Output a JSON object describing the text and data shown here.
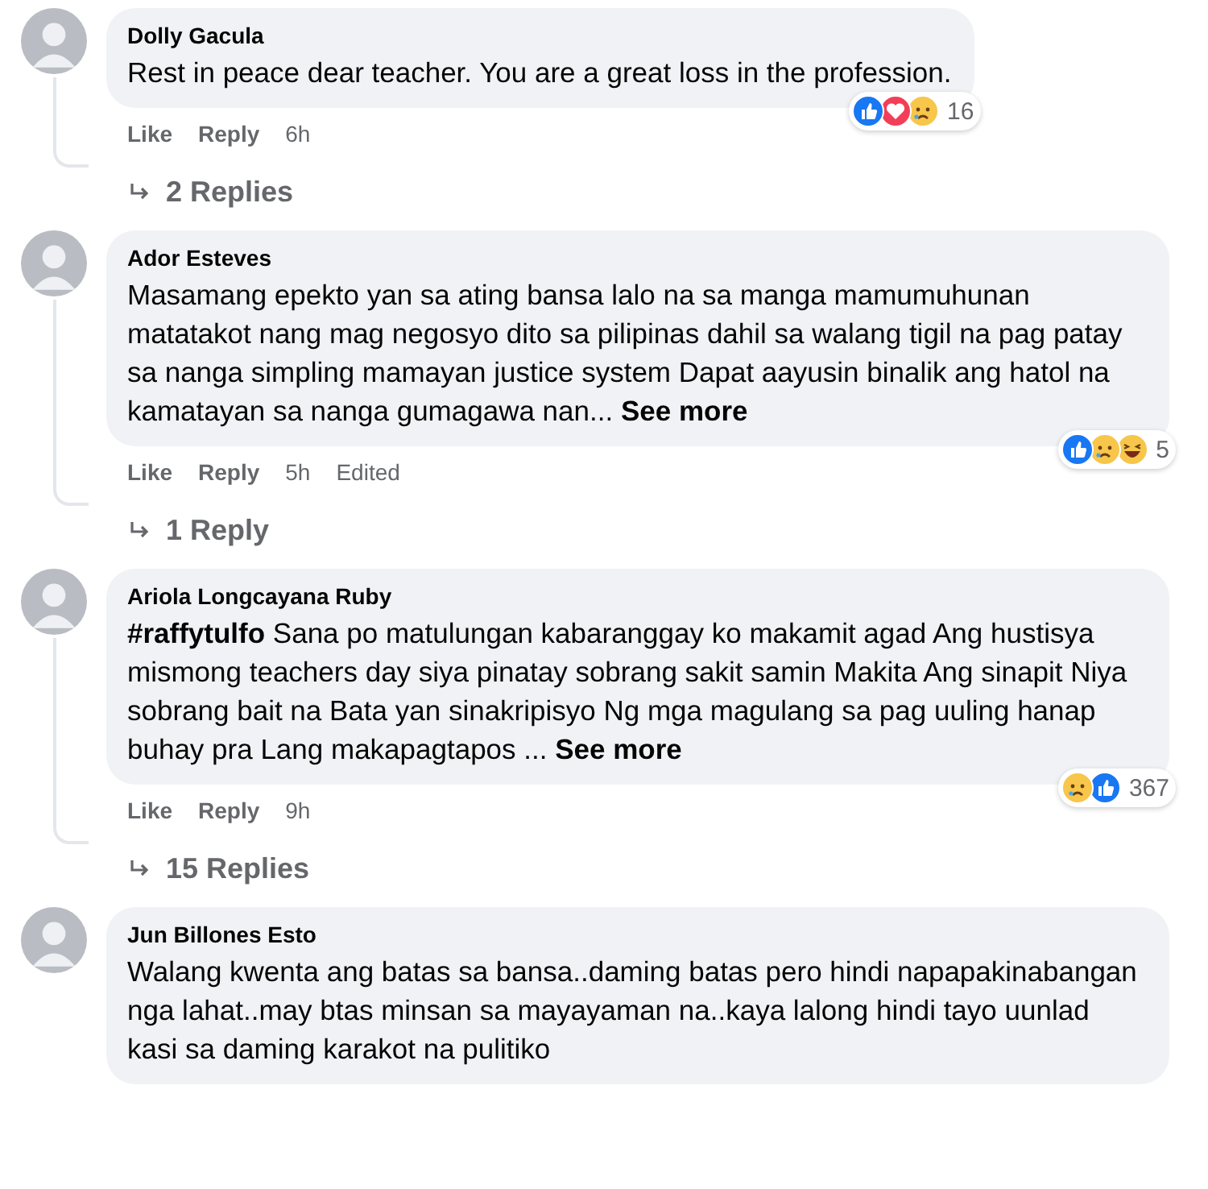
{
  "comments": [
    {
      "author": "Dolly Gacula",
      "body": "Rest in peace dear teacher. You are a great loss in the profession.",
      "actions": [
        "Like",
        "Reply"
      ],
      "time": "6h",
      "reactions": [
        {
          "kind": "like"
        },
        {
          "kind": "love"
        },
        {
          "kind": "sad"
        }
      ],
      "reaction_count": "16",
      "replies": "2 Replies"
    },
    {
      "author": "Ador Esteves",
      "body": "Masamang epekto yan sa ating bansa lalo na sa manga mamumuhunan matatakot nang mag negosyo dito sa pilipinas dahil sa walang tigil na pag patay sa nanga simpling mamayan justice system Dapat aayusin binalik ang hatol na kamatayan sa nanga gumagawa nan... **See more**",
      "actions": [
        "Like",
        "Reply"
      ],
      "time": "5h",
      "edited": "Edited",
      "reactions": [
        {
          "kind": "like"
        },
        {
          "kind": "sad"
        },
        {
          "kind": "haha"
        }
      ],
      "reaction_count": "5",
      "replies": "1 Reply"
    },
    {
      "author": "Ariola Longcayana Ruby",
      "body": "**#raffytulfo** Sana po matulungan kabaranggay ko makamit agad Ang hustisya mismong teachers day siya pinatay sobrang sakit samin Makita Ang sinapit Niya sobrang bait na Bata yan sinakripisyo Ng mga magulang sa pag uuling hanap buhay pra Lang makapagtapos ... **See more**",
      "actions": [
        "Like",
        "Reply"
      ],
      "time": "9h",
      "reactions": [
        {
          "kind": "sad"
        },
        {
          "kind": "like"
        }
      ],
      "reaction_count": "367",
      "replies": "15 Replies"
    },
    {
      "author": "Jun Billones Esto",
      "body": "Walang kwenta ang batas sa bansa..daming batas pero hindi napapakinabangan nga lahat..may btas minsan sa mayayaman na..kaya lalong hindi tayo uunlad kasi sa daming karakot na pulitiko"
    }
  ]
}
